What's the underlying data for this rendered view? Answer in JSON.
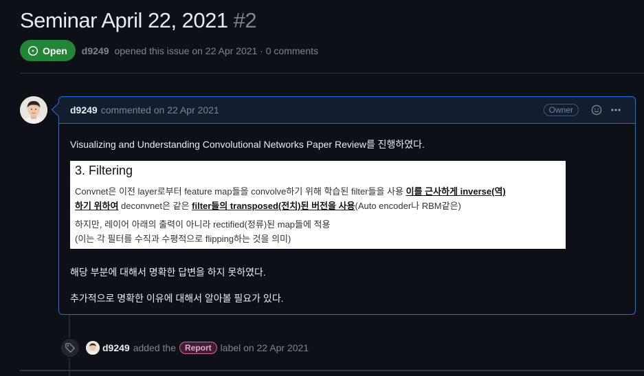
{
  "issue": {
    "title": "Seminar April 22, 2021",
    "number": "#2",
    "state_label": "Open",
    "author": "d9249",
    "opened_text": "opened this issue on 22 Apr 2021 · 0 comments"
  },
  "comment": {
    "author": "d9249",
    "meta": "commented on 22 Apr 2021",
    "role_badge": "Owner",
    "body_line1": "Visualizing and Understanding Convolutional Networks Paper Review를 진행하였다.",
    "embed": {
      "heading": "3. Filtering",
      "p1_a": "Convnet은 이전 layer로부터 feature map들을 convolve하기 위해 학습된 filter들을 사용 ",
      "p1_b": "이를 근사하게 inverse(역)",
      "p2_a": "하기 위하여",
      "p2_b": " deconvnet은 같은 ",
      "p2_c": "filter들의 transposed(전치)된 버전을 사용",
      "p2_d": "(Auto encoder나 RBM같은)",
      "p3": "하지만, 레이어 아래의 출력이 아니라 rectified(정류)된 map들에 적용",
      "p4": "(이는 각 필터를 수직과 수평적으로 flipping하는 것을 의미)"
    },
    "body_line2": "해당 부분에 대해서 명확한 답변을 하지 못하였다.",
    "body_line3": "추가적으로 명확한 이유에 대해서 알아볼 필요가 있다."
  },
  "event": {
    "author": "d9249",
    "action": "added the",
    "label": "Report",
    "suffix": "label on 22 Apr 2021"
  },
  "colors": {
    "background": "#0d1117",
    "open_green": "#238636",
    "accent_blue": "#1f6feb",
    "label_pink": "#db61a2"
  },
  "icons": [
    "issue-opened-icon",
    "smiley-icon",
    "kebab-horizontal-icon",
    "tag-icon",
    "avatar-image"
  ]
}
